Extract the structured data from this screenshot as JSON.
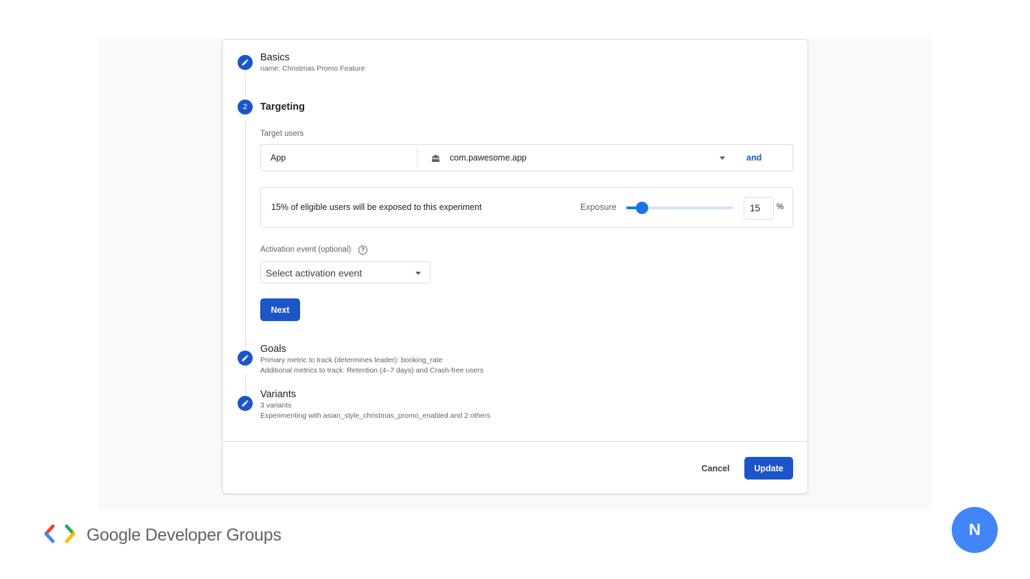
{
  "steps": {
    "basics": {
      "title": "Basics",
      "sub": "name: Christmas Promo Feature"
    },
    "targeting": {
      "number": "2",
      "title": "Targeting",
      "target_users_label": "Target users",
      "app_label": "App",
      "package": "com.pawesome.app",
      "and_label": "and",
      "exposure_text": "15% of eligible users will be exposed to this experiment",
      "exposure_label": "Exposure",
      "exposure_value": "15",
      "exposure_fraction": 0.15,
      "percent_sign": "%",
      "activation_label": "Activation event (optional)",
      "activation_placeholder": "Select activation event",
      "next_label": "Next"
    },
    "goals": {
      "title": "Goals",
      "sub1": "Primary metric to track (determines leader): booking_rate",
      "sub2": "Additional metrics to track: Retention (4–7 days) and Crash-free users"
    },
    "variants": {
      "title": "Variants",
      "sub1": "3 variants",
      "sub2": "Experimenting with asian_style_christmas_promo_enabled and 2 others"
    }
  },
  "footer": {
    "cancel_label": "Cancel",
    "update_label": "Update"
  },
  "branding": {
    "text": "Google Developer Groups"
  },
  "avatar": {
    "initial": "N"
  },
  "colors": {
    "primary": "#1a56c8",
    "slider": "#1a73e8",
    "avatar": "#4285f4"
  },
  "icons": [
    "edit-icon",
    "android-icon",
    "help-icon",
    "dropdown-caret-icon",
    "gdg-logo"
  ]
}
